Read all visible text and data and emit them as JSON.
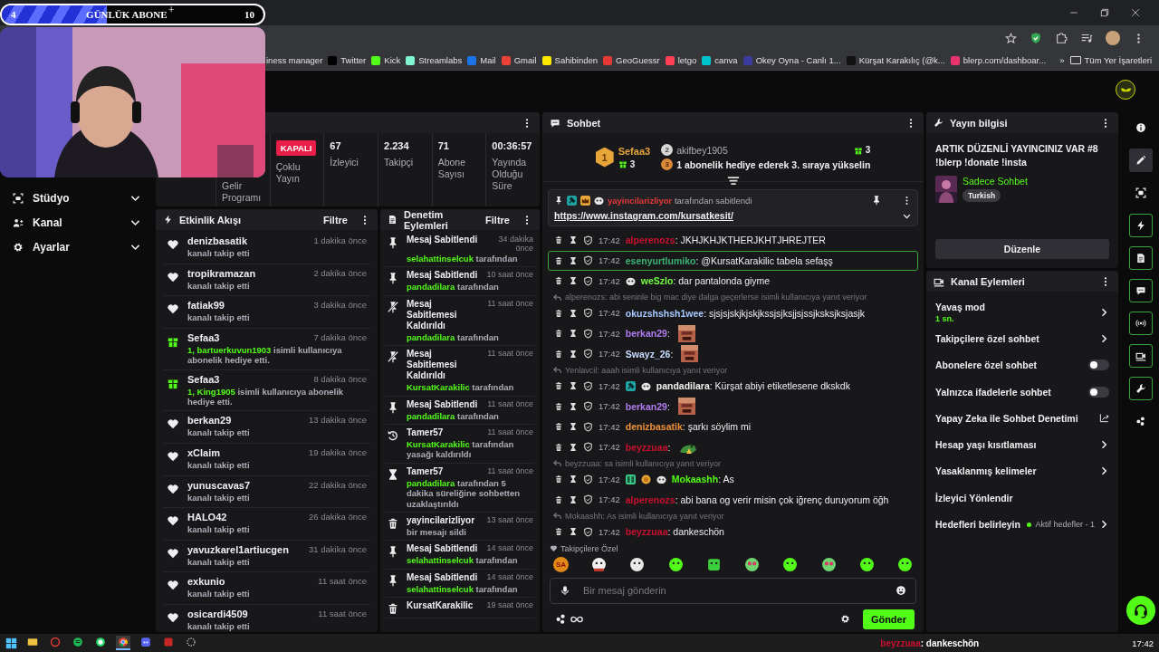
{
  "goal": {
    "current": "4",
    "title": "GÜNLÜK ABONE",
    "plus": "+",
    "target": "10",
    "level": 0.4
  },
  "browser": {
    "bookmarks": [
      {
        "label": "iness manager"
      },
      {
        "label": "Twitter",
        "color": "#000000"
      },
      {
        "label": "Kick",
        "color": "#53fc18"
      },
      {
        "label": "Streamlabs",
        "color": "#80f5d2"
      },
      {
        "label": "Mail",
        "color": "#1a73e8"
      },
      {
        "label": "Gmail",
        "color": "#ea4335"
      },
      {
        "label": "Sahibinden",
        "color": "#ffe800"
      },
      {
        "label": "GeoGuessr",
        "color": "#e53935"
      },
      {
        "label": "letgo",
        "color": "#ff3f55"
      },
      {
        "label": "canva",
        "color": "#00c4cc"
      },
      {
        "label": "Okey Oyna - Canlı 1...",
        "color": "#3b3b9e"
      },
      {
        "label": "Kürşat Karakılıç (@k...",
        "color": "#111111"
      },
      {
        "label": "blerp.com/dashboar...",
        "color": "#e8336d"
      }
    ],
    "overflow": "»",
    "all_bookmarks": "Tüm Yer İşaretleri"
  },
  "sidebar": {
    "items": [
      {
        "label": "Stüdyo",
        "kind": "studio",
        "expanded": false
      },
      {
        "label": "Kanal",
        "kind": "people",
        "expanded": false
      },
      {
        "label": "Ayarlar",
        "kind": "gear",
        "expanded": false
      }
    ]
  },
  "stats": [
    {
      "kind": "label",
      "label": "Gelir Programı"
    },
    {
      "kind": "badge",
      "badge": "KAPALI",
      "label": "Çoklu Yayın"
    },
    {
      "kind": "value",
      "value": "67",
      "label": "İzleyici"
    },
    {
      "kind": "value",
      "value": "2.234",
      "label": "Takipçi"
    },
    {
      "kind": "value",
      "value": "71",
      "label": "Abone Sayısı"
    },
    {
      "kind": "value",
      "value": "00:36:57",
      "label": "Yayında Olduğu Süre"
    }
  ],
  "activity": {
    "title": "Etkinlik Akışı",
    "filter": "Filtre",
    "items": [
      {
        "kind": "follow",
        "name": "denizbasatik",
        "time": "1 dakika önce",
        "text": "kanalı takip etti"
      },
      {
        "kind": "follow",
        "name": "tropikramazan",
        "time": "2 dakika önce",
        "text": "kanalı takip etti"
      },
      {
        "kind": "follow",
        "name": "fatiak99",
        "time": "3 dakika önce",
        "text": "kanalı takip etti"
      },
      {
        "kind": "gift",
        "name": "Sefaa3",
        "time": "7 dakika önce",
        "highlight": "1, bartuerkuvun1903",
        "text": "isimli kullanıcıya abonelik hediye etti."
      },
      {
        "kind": "gift",
        "name": "Sefaa3",
        "time": "8 dakika önce",
        "highlight": "1, King1905",
        "text": "isimli kullanıcıya abonelik hediye etti."
      },
      {
        "kind": "follow",
        "name": "berkan29",
        "time": "13 dakika önce",
        "text": "kanalı takip etti"
      },
      {
        "kind": "follow",
        "name": "xClaim",
        "time": "19 dakika önce",
        "text": "kanalı takip etti"
      },
      {
        "kind": "follow",
        "name": "yunuscavas7",
        "time": "22 dakika önce",
        "text": "kanalı takip etti"
      },
      {
        "kind": "follow",
        "name": "HALO42",
        "time": "26 dakika önce",
        "text": "kanalı takip etti"
      },
      {
        "kind": "follow",
        "name": "yavuzkarel1artiucgen",
        "time": "31 dakika önce",
        "text": "kanalı takip etti"
      },
      {
        "kind": "follow",
        "name": "exkunio",
        "time": "11 saat önce",
        "text": "kanalı takip etti"
      },
      {
        "kind": "follow",
        "name": "osicardi4509",
        "time": "11 saat önce",
        "text": "kanalı takip etti"
      }
    ]
  },
  "moderation": {
    "title": "Denetim Eylemleri",
    "filter": "Filtre",
    "items": [
      {
        "kind": "pin",
        "title": "Mesaj Sabitlendi",
        "time": "34 dakika önce",
        "actor": "selahattinselcuk",
        "text": "tarafından"
      },
      {
        "kind": "pin",
        "title": "Mesaj Sabitlendi",
        "time": "10 saat önce",
        "actor": "pandadilara",
        "text": "tarafından"
      },
      {
        "kind": "unpin",
        "title": "Mesaj Sabitlemesi Kaldırıldı",
        "time": "11 saat önce",
        "actor": "pandadilara",
        "text": "tarafından"
      },
      {
        "kind": "unpin",
        "title": "Mesaj Sabitlemesi Kaldırıldı",
        "time": "11 saat önce",
        "actor": "KursatKarakilic",
        "text": "tarafından"
      },
      {
        "kind": "pin",
        "title": "Mesaj Sabitlendi",
        "time": "11 saat önce",
        "actor": "pandadilara",
        "text": "tarafından"
      },
      {
        "kind": "unban",
        "title": "Tamer57",
        "time": "11 saat önce",
        "actor": "KursatKarakilic",
        "text": "tarafından yasağı kaldırıldı"
      },
      {
        "kind": "timeout",
        "title": "Tamer57",
        "time": "11 saat önce",
        "actor": "pandadilara",
        "text": "tarafından 5 dakika süreliğine sohbetten uzaklaştırıldı"
      },
      {
        "kind": "delete",
        "title": "yayincilarizliyor",
        "time": "13 saat önce",
        "text": "bir mesajı sildi"
      },
      {
        "kind": "pin",
        "title": "Mesaj Sabitlendi",
        "time": "14 saat önce",
        "actor": "selahattinselcuk",
        "text": "tarafından"
      },
      {
        "kind": "pin",
        "title": "Mesaj Sabitlendi",
        "time": "14 saat önce",
        "actor": "selahattinselcuk",
        "text": "tarafından"
      },
      {
        "kind": "delete",
        "title": "KursatKarakilic",
        "time": "19 saat önce"
      }
    ]
  },
  "chat": {
    "title": "Sohbet",
    "leaders": [
      {
        "rank": "1",
        "name": "Sefaa3",
        "gifts": "3"
      },
      {
        "rank": "2",
        "name": "akifbey1905",
        "gifts": "3"
      }
    ],
    "cta": {
      "rank": "3",
      "text": "1 abonelik hediye ederek 3. sıraya yükselin"
    },
    "pinned": {
      "author": "yayincilarizliyor",
      "by": "tarafından sabitlendi",
      "link": "https://www.instagram.com/kursatkesit/"
    },
    "messages": [
      {
        "kind": "text",
        "time": "17:42",
        "user": "alperenozs",
        "color": "#c8102e",
        "text": ": JKHJKHJKTHERJKHTJHREJTER",
        "highlighted": false
      },
      {
        "kind": "text",
        "time": "17:42",
        "user": "esenyurtlumiko",
        "color": "#3cb371",
        "text": ": @KursatKarakilic tabela sefaşş",
        "highlighted": true
      },
      {
        "kind": "text",
        "time": "17:42",
        "user": "weSzlo",
        "color": "#75fd46",
        "badges": [
          {
            "kind": "bear"
          }
        ],
        "text": ": dar pantalonda giyme",
        "highlighted": false
      },
      {
        "kind": "reply",
        "text": "alperenozs: abi seninle big mac diye dalga geçerlerse isimli kullanıcıya yanıt veriyor"
      },
      {
        "kind": "text",
        "time": "17:42",
        "user": "okuzshshsh1wee",
        "color": "#a8c8ff",
        "text": ": sjsjsjskjkjskjkssjsjksjjsjssjksksjksjasjk",
        "highlighted": false
      },
      {
        "kind": "emote",
        "time": "17:42",
        "user": "berkan29",
        "color": "#b07cf0",
        "text": ":",
        "highlighted": false
      },
      {
        "kind": "emote",
        "time": "17:42",
        "user": "Swayz_26",
        "color": "#c9dcff",
        "text": ":",
        "highlighted": false
      },
      {
        "kind": "reply",
        "text": "Yenlavcil: aaah isimli kullanıcıya yanıt veriyor"
      },
      {
        "kind": "text",
        "time": "17:42",
        "user": "pandadilara",
        "color": "#f2f2f2",
        "badges": [
          {
            "kind": "mod"
          },
          {
            "kind": "bear"
          }
        ],
        "text": ": Kürşat abiyi etiketlesene dkskdk",
        "highlighted": false
      },
      {
        "kind": "emote",
        "time": "17:42",
        "user": "berkan29",
        "color": "#b07cf0",
        "text": ":",
        "highlighted": false
      },
      {
        "kind": "text",
        "time": "17:42",
        "user": "denizbasatik",
        "color": "#f0923a",
        "text": ": şarkı söylim mi",
        "highlighted": false
      },
      {
        "kind": "sticker",
        "time": "17:42",
        "user": "beyzzuaa",
        "color": "#c8102e",
        "text": ":",
        "highlighted": false
      },
      {
        "kind": "reply",
        "text": "beyzzuaa: sa isimli kullanıcıya yanıt veriyor"
      },
      {
        "kind": "text",
        "time": "17:42",
        "user": "Mokaashh",
        "color": "#53fc18",
        "badges": [
          {
            "kind": "sub"
          },
          {
            "kind": "gold"
          },
          {
            "kind": "bear"
          }
        ],
        "text": ": As",
        "highlighted": false
      },
      {
        "kind": "text",
        "time": "17:42",
        "user": "alperenozs",
        "color": "#c8102e",
        "text": ": abi bana og verir misin çok iğrenç duruyorum öğh",
        "highlighted": false
      },
      {
        "kind": "reply",
        "text": "Mokaashh: As isimli kullanıcıya yanıt veriyor"
      },
      {
        "kind": "text",
        "time": "17:42",
        "user": "beyzzuaa",
        "color": "#c8102e",
        "text": ": dankeschön",
        "highlighted": false
      }
    ],
    "emote_bar": {
      "label": "Takipçilere Özel",
      "emotes": [
        {
          "kind": "text",
          "text": "SA"
        },
        {
          "kind": "panda"
        },
        {
          "kind": "face"
        },
        {
          "kind": "blob"
        },
        {
          "kind": "box"
        },
        {
          "kind": "eyes"
        },
        {
          "kind": "blob"
        },
        {
          "kind": "eyes"
        },
        {
          "kind": "blob"
        },
        {
          "kind": "blob"
        }
      ]
    },
    "input": {
      "placeholder": "Bir mesaj gönderin"
    },
    "send": "Gönder"
  },
  "stream_info": {
    "title": "Yayın bilgisi",
    "stream_title": "ARTIK DÜZENLİ YAYINCINIZ VAR #8 !blerp !donate !insta",
    "category": "Sadece Sohbet",
    "tag": "Turkish",
    "edit": "Düzenle"
  },
  "channel_actions": {
    "title": "Kanal Eylemleri",
    "items": [
      {
        "kind": "submenu",
        "label": "Yavaş mod",
        "value": "1 sn."
      },
      {
        "kind": "submenu",
        "label": "Takipçilere özel sohbet"
      },
      {
        "kind": "toggle",
        "label": "Abonelere özel sohbet",
        "on": false
      },
      {
        "kind": "toggle",
        "label": "Yalnızca ifadelerle sohbet",
        "on": false
      },
      {
        "kind": "external",
        "label": "Yapay Zeka ile Sohbet Denetimi"
      },
      {
        "kind": "submenu",
        "label": "Hesap yaşı kısıtlaması"
      },
      {
        "kind": "submenu",
        "label": "Yasaklanmış kelimeler"
      },
      {
        "kind": "plain",
        "label": "İzleyici Yönlendir"
      },
      {
        "kind": "submenu",
        "label": "Hedefleri belirleyin",
        "status": "Aktif hedefler - 1",
        "color": "#53fc18"
      }
    ]
  },
  "rail": [
    {
      "kind": "info",
      "selected": false,
      "highlighted": false
    },
    {
      "kind": "pencil",
      "selected": true,
      "highlighted": false
    },
    {
      "kind": "capture",
      "selected": false,
      "highlighted": false
    },
    {
      "kind": "bolt",
      "selected": false,
      "highlighted": true
    },
    {
      "kind": "doc",
      "selected": false,
      "highlighted": true
    },
    {
      "kind": "chat",
      "selected": false,
      "highlighted": true
    },
    {
      "kind": "broadcast",
      "selected": false,
      "highlighted": true
    },
    {
      "kind": "camera",
      "selected": false,
      "highlighted": true
    },
    {
      "kind": "wrench",
      "selected": false,
      "highlighted": true
    },
    {
      "kind": "cluster",
      "selected": false,
      "highlighted": false
    }
  ],
  "taskbar": {
    "apps": [
      {
        "kind": "folder",
        "selected": false
      },
      {
        "kind": "red",
        "selected": false
      },
      {
        "kind": "spotify",
        "selected": false
      },
      {
        "kind": "whatsapp",
        "selected": false
      },
      {
        "kind": "chrome",
        "selected": true
      },
      {
        "kind": "discord",
        "selected": false
      },
      {
        "kind": "redsquare",
        "selected": false
      },
      {
        "kind": "ring",
        "selected": false
      }
    ],
    "notification": {
      "user": "beyzzuaa",
      "color": "#c8102e",
      "text": ": dankeschön"
    },
    "time": "17:42"
  }
}
